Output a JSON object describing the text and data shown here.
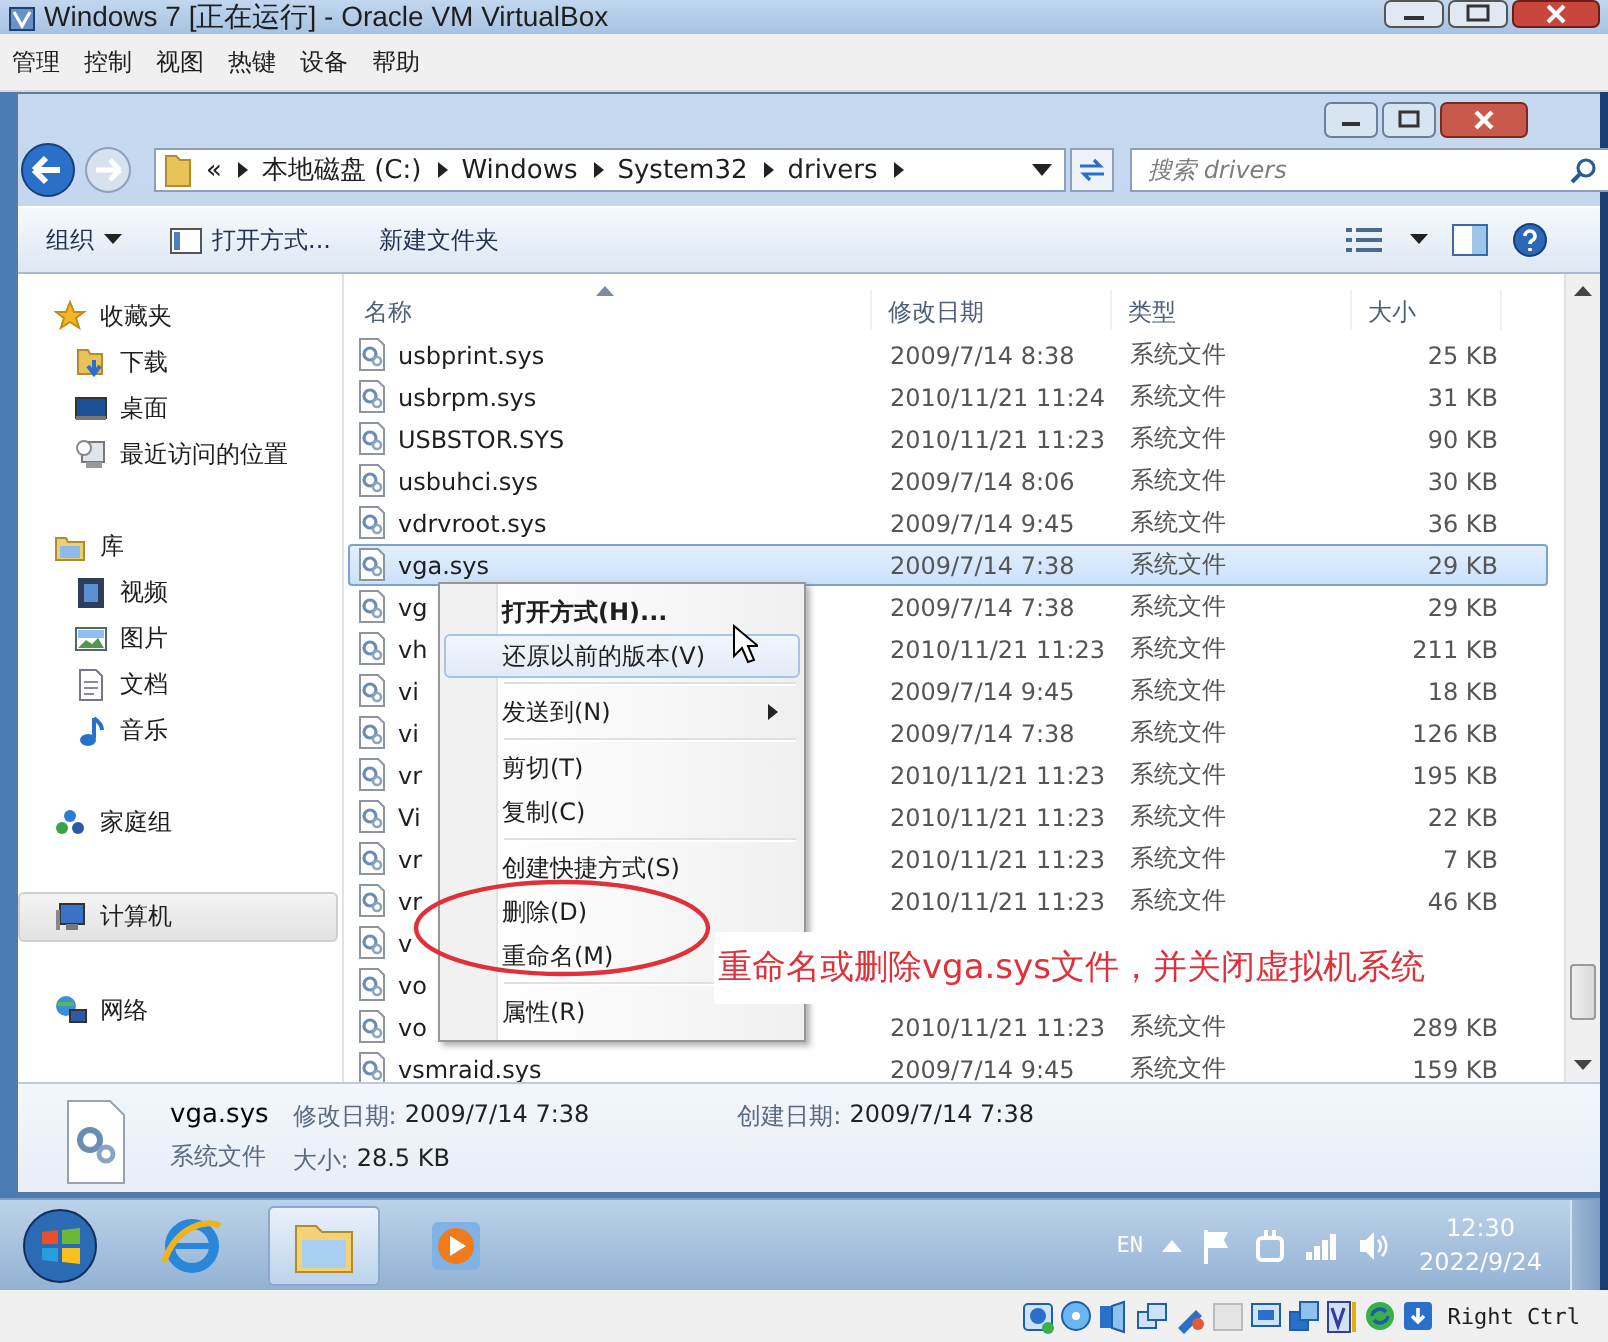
{
  "vm_window": {
    "title": "Windows 7 [正在运行] - Oracle VM VirtualBox"
  },
  "vm_menu": [
    "管理",
    "控制",
    "视图",
    "热键",
    "设备",
    "帮助"
  ],
  "address": {
    "segments": [
      "«",
      "本地磁盘 (C:)",
      "Windows",
      "System32",
      "drivers"
    ]
  },
  "search": {
    "placeholder": "搜索 drivers"
  },
  "toolbar": [
    {
      "label": "组织",
      "kind": "dropdown"
    },
    {
      "label": "打开方式...",
      "kind": "open"
    },
    {
      "label": "新建文件夹",
      "kind": "plain"
    }
  ],
  "nav": [
    {
      "label": "收藏夹",
      "kind": "star",
      "selected": false,
      "children": [
        {
          "label": "下载",
          "kind": "download",
          "selected": false
        },
        {
          "label": "桌面",
          "kind": "desktop",
          "selected": false
        },
        {
          "label": "最近访问的位置",
          "kind": "recent",
          "selected": false
        }
      ]
    },
    {
      "label": "库",
      "kind": "library",
      "selected": false,
      "children": [
        {
          "label": "视频",
          "kind": "video",
          "selected": false
        },
        {
          "label": "图片",
          "kind": "picture",
          "selected": false
        },
        {
          "label": "文档",
          "kind": "document",
          "selected": false
        },
        {
          "label": "音乐",
          "kind": "music",
          "selected": false
        }
      ]
    },
    {
      "label": "家庭组",
      "kind": "homegroup",
      "selected": false
    },
    {
      "label": "计算机",
      "kind": "computer",
      "selected": true
    },
    {
      "label": "网络",
      "kind": "network",
      "selected": false
    }
  ],
  "columns": [
    "名称",
    "修改日期",
    "类型",
    "大小"
  ],
  "rows": [
    {
      "name": "usbprint.sys",
      "date": "2009/7/14 8:38",
      "type": "系统文件",
      "size": "25 KB",
      "selected": false
    },
    {
      "name": "usbrpm.sys",
      "date": "2010/11/21 11:24",
      "type": "系统文件",
      "size": "31 KB",
      "selected": false
    },
    {
      "name": "USBSTOR.SYS",
      "date": "2010/11/21 11:23",
      "type": "系统文件",
      "size": "90 KB",
      "selected": false
    },
    {
      "name": "usbuhci.sys",
      "date": "2009/7/14 8:06",
      "type": "系统文件",
      "size": "30 KB",
      "selected": false
    },
    {
      "name": "vdrvroot.sys",
      "date": "2009/7/14 9:45",
      "type": "系统文件",
      "size": "36 KB",
      "selected": false
    },
    {
      "name": "vga.sys",
      "date": "2009/7/14 7:38",
      "type": "系统文件",
      "size": "29 KB",
      "selected": true
    },
    {
      "name": "vg",
      "date": "2009/7/14 7:38",
      "type": "系统文件",
      "size": "29 KB",
      "selected": false
    },
    {
      "name": "vh",
      "date": "2010/11/21 11:23",
      "type": "系统文件",
      "size": "211 KB",
      "selected": false
    },
    {
      "name": "vi",
      "date": "2009/7/14 9:45",
      "type": "系统文件",
      "size": "18 KB",
      "selected": false
    },
    {
      "name": "vi",
      "date": "2009/7/14 7:38",
      "type": "系统文件",
      "size": "126 KB",
      "selected": false
    },
    {
      "name": "vr",
      "date": "2010/11/21 11:23",
      "type": "系统文件",
      "size": "195 KB",
      "selected": false
    },
    {
      "name": "Vi",
      "date": "2010/11/21 11:23",
      "type": "系统文件",
      "size": "22 KB",
      "selected": false
    },
    {
      "name": "vr",
      "date": "2010/11/21 11:23",
      "type": "系统文件",
      "size": "7 KB",
      "selected": false
    },
    {
      "name": "vr",
      "date": "2010/11/21 11:23",
      "type": "系统文件",
      "size": "46 KB",
      "selected": false
    },
    {
      "name": "v",
      "selected": false
    },
    {
      "name": "vo",
      "selected": false
    },
    {
      "name": "vo",
      "date": "2010/11/21 11:23",
      "type": "系统文件",
      "size": "289 KB",
      "selected": false
    },
    {
      "name": "vsmraid.sys",
      "date": "2009/7/14 9:45",
      "type": "系统文件",
      "size": "159 KB",
      "selected": false
    }
  ],
  "context_menu": [
    {
      "kind": "item",
      "label": "打开方式(H)...",
      "bold": true,
      "selected": false
    },
    {
      "kind": "item",
      "label": "还原以前的版本(V)",
      "bold": false,
      "selected": true
    },
    {
      "kind": "separator"
    },
    {
      "kind": "submenu",
      "label": "发送到(N)",
      "bold": false,
      "selected": false
    },
    {
      "kind": "separator"
    },
    {
      "kind": "item",
      "label": "剪切(T)",
      "bold": false,
      "selected": false
    },
    {
      "kind": "item",
      "label": "复制(C)",
      "bold": false,
      "selected": false
    },
    {
      "kind": "separator"
    },
    {
      "kind": "item",
      "label": "创建快捷方式(S)",
      "bold": false,
      "selected": false
    },
    {
      "kind": "item",
      "label": "删除(D)",
      "bold": false,
      "selected": false
    },
    {
      "kind": "item",
      "label": "重命名(M)",
      "bold": false,
      "selected": false
    },
    {
      "kind": "separator"
    },
    {
      "kind": "item",
      "label": "属性(R)",
      "bold": false,
      "selected": false
    }
  ],
  "annotation": {
    "text": "重命名或删除vga.sys文件，并关闭虚拟机系统"
  },
  "details": {
    "name": "vga.sys",
    "type": "系统文件",
    "fields": [
      {
        "label": "修改日期:",
        "value": "2009/7/14 7:38"
      },
      {
        "label": "大小:",
        "value": "28.5 KB"
      },
      {
        "label": "创建日期:",
        "value": "2009/7/14 7:38"
      }
    ]
  },
  "taskbar": {
    "apps": [
      {
        "kind": "browser",
        "selected": false
      },
      {
        "kind": "folder",
        "selected": true
      },
      {
        "kind": "media",
        "selected": false
      }
    ],
    "language": "EN",
    "time": "12:30",
    "date": "2022/9/24"
  },
  "vm_status": {
    "host_key": "Right Ctrl"
  }
}
